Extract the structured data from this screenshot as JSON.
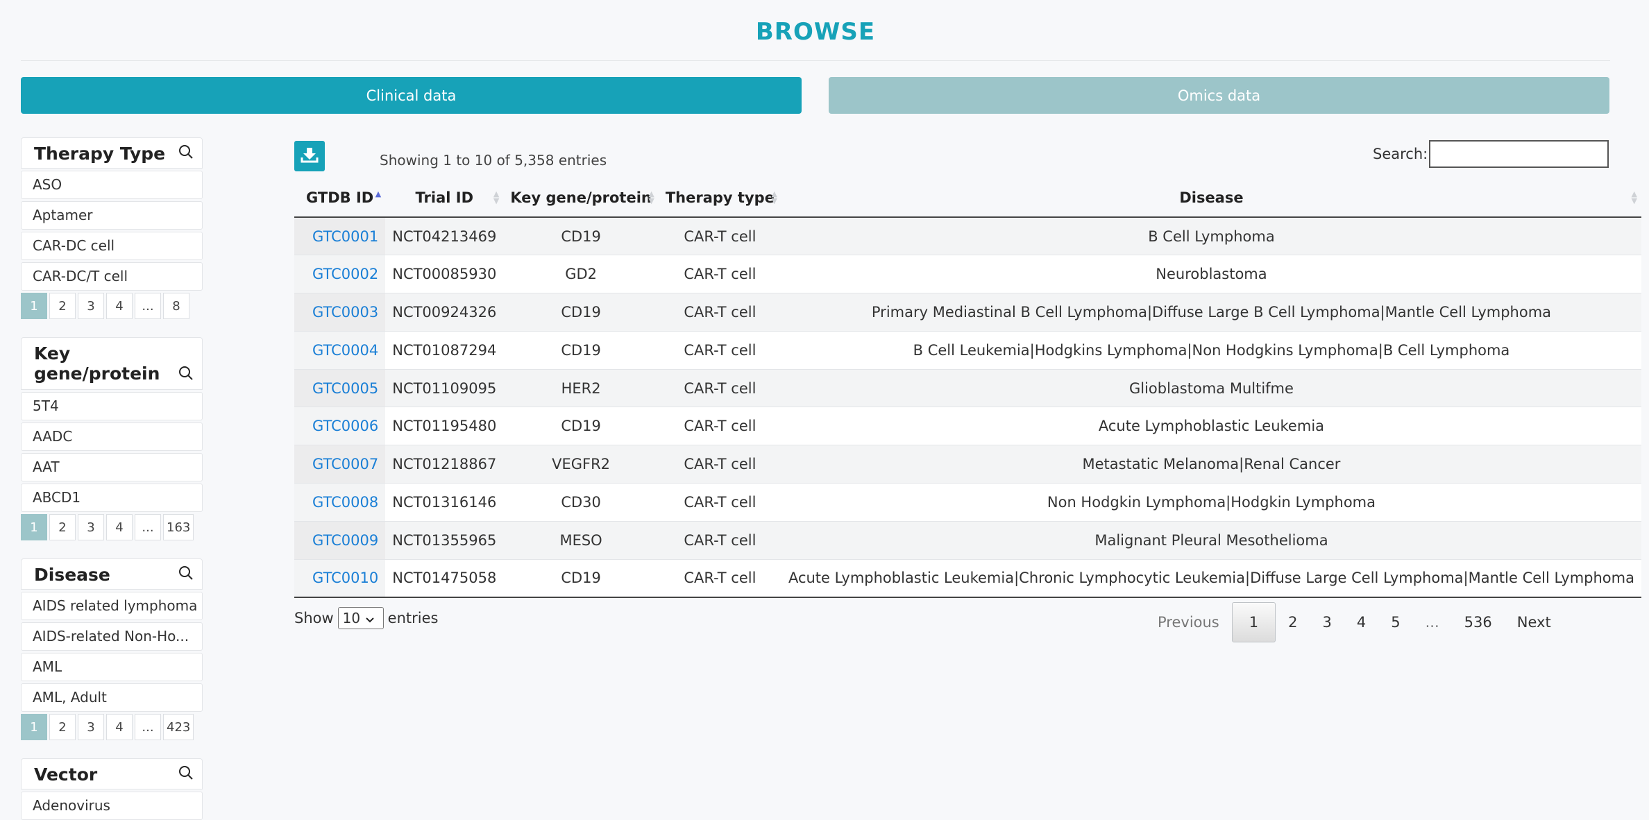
{
  "page": {
    "title": "BROWSE"
  },
  "tabs": {
    "clinical": "Clinical data",
    "omics": "Omics data"
  },
  "colors": {
    "accent": "#17a2b8",
    "inactive_tab": "#9cc5c9",
    "link": "#1a7fd6"
  },
  "sidebar": {
    "therapy_type": {
      "heading": "Therapy Type",
      "items": [
        "ASO",
        "Aptamer",
        "CAR-DC cell",
        "CAR-DC/T cell"
      ],
      "pages": [
        "1",
        "2",
        "3",
        "4",
        "...",
        "8"
      ]
    },
    "key_gene": {
      "heading": "Key gene/protein",
      "items": [
        "5T4",
        "AADC",
        "AAT",
        "ABCD1"
      ],
      "pages": [
        "1",
        "2",
        "3",
        "4",
        "...",
        "163"
      ]
    },
    "disease": {
      "heading": "Disease",
      "items": [
        "AIDS related lymphoma",
        "AIDS-related Non-Ho...",
        "AML",
        "AML, Adult"
      ],
      "pages": [
        "1",
        "2",
        "3",
        "4",
        "...",
        "423"
      ]
    },
    "vector": {
      "heading": "Vector",
      "items": [
        "Adenovirus"
      ]
    }
  },
  "toolbar": {
    "download_icon": "download-icon",
    "info": "Showing 1 to 10 of 5,358 entries",
    "search_label": "Search:",
    "search_value": ""
  },
  "table": {
    "columns": [
      "GTDB ID",
      "Trial ID",
      "Key gene/protein",
      "Therapy type",
      "Disease"
    ],
    "rows": [
      [
        "GTC0001",
        "NCT04213469",
        "CD19",
        "CAR-T cell",
        "B Cell Lymphoma"
      ],
      [
        "GTC0002",
        "NCT00085930",
        "GD2",
        "CAR-T cell",
        "Neuroblastoma"
      ],
      [
        "GTC0003",
        "NCT00924326",
        "CD19",
        "CAR-T cell",
        "Primary Mediastinal B Cell Lymphoma|Diffuse Large B Cell Lymphoma|Mantle Cell Lymphoma"
      ],
      [
        "GTC0004",
        "NCT01087294",
        "CD19",
        "CAR-T cell",
        "B Cell Leukemia|Hodgkins Lymphoma|Non Hodgkins Lymphoma|B Cell Lymphoma"
      ],
      [
        "GTC0005",
        "NCT01109095",
        "HER2",
        "CAR-T cell",
        "Glioblastoma Multifme"
      ],
      [
        "GTC0006",
        "NCT01195480",
        "CD19",
        "CAR-T cell",
        "Acute Lymphoblastic Leukemia"
      ],
      [
        "GTC0007",
        "NCT01218867",
        "VEGFR2",
        "CAR-T cell",
        "Metastatic Melanoma|Renal Cancer"
      ],
      [
        "GTC0008",
        "NCT01316146",
        "CD30",
        "CAR-T cell",
        "Non Hodgkin Lymphoma|Hodgkin Lymphoma"
      ],
      [
        "GTC0009",
        "NCT01355965",
        "MESO",
        "CAR-T cell",
        "Malignant Pleural Mesothelioma"
      ],
      [
        "GTC0010",
        "NCT01475058",
        "CD19",
        "CAR-T cell",
        "Acute Lymphoblastic Leukemia|Chronic Lymphocytic Leukemia|Diffuse Large Cell Lymphoma|Mantle Cell Lymphoma"
      ]
    ]
  },
  "footer": {
    "show_label": "Show",
    "show_value": "10",
    "entries_label": "entries",
    "previous": "Previous",
    "next": "Next",
    "pages": [
      "1",
      "2",
      "3",
      "4",
      "5",
      "...",
      "536"
    ]
  }
}
